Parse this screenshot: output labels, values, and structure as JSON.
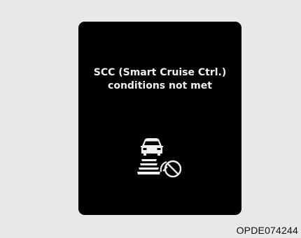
{
  "display": {
    "message_line1": "SCC (Smart Cruise Ctrl.)",
    "message_line2": "conditions not met",
    "icon": "scc-conditions-not-met-icon",
    "background_color": "#000000",
    "text_color": "#f0f0f0"
  },
  "figure_code": "OPDE074244"
}
